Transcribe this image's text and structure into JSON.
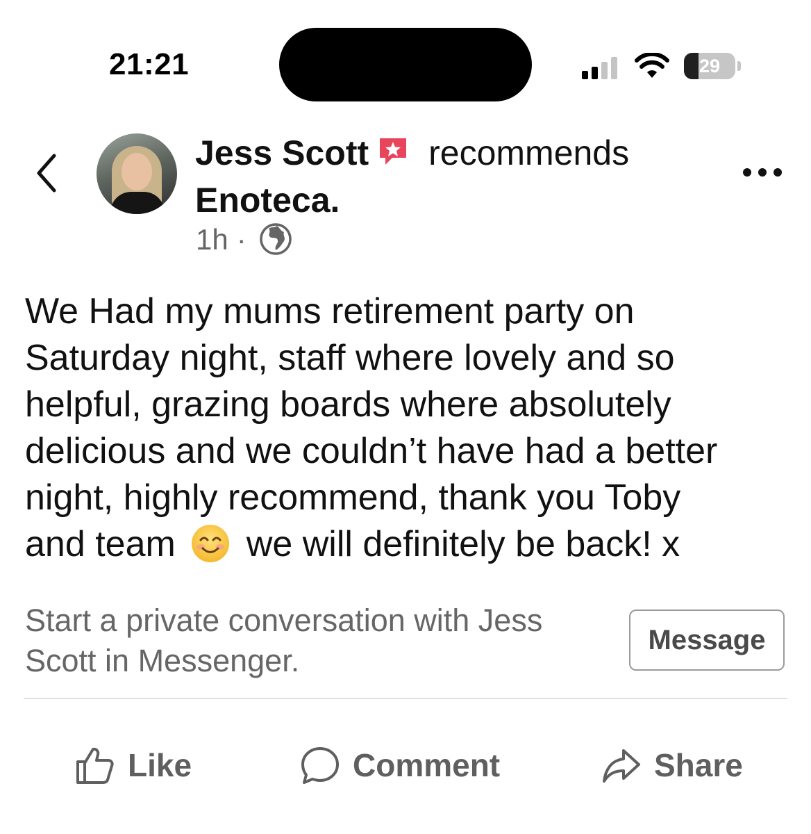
{
  "status_bar": {
    "time": "21:21",
    "battery": "29",
    "battery_level_percent": 29
  },
  "post": {
    "author": "Jess Scott",
    "action": "recommends",
    "page": "Enoteca.",
    "time_ago": "1h",
    "separator": "·",
    "audience_icon": "globe-icon",
    "body_lines": [
      "We Had my mums retirement party on",
      "Saturday night, staff where lovely and so",
      "helpful, grazing boards where absolutely",
      "delicious and we couldn’t have had a better",
      "night, highly recommend, thank you Toby",
      "and team",
      "we will definitely be back! x"
    ],
    "emoji": "smiling-face-emoji"
  },
  "messenger": {
    "prompt_lines": [
      "Start a private conversation with Jess",
      "Scott in Messenger."
    ],
    "button_label": "Message"
  },
  "actions": {
    "like": "Like",
    "comment": "Comment",
    "share": "Share"
  },
  "colors": {
    "recommend_badge": "#e8445a",
    "secondary_text": "#656565",
    "action_text": "#5f5f5f"
  }
}
